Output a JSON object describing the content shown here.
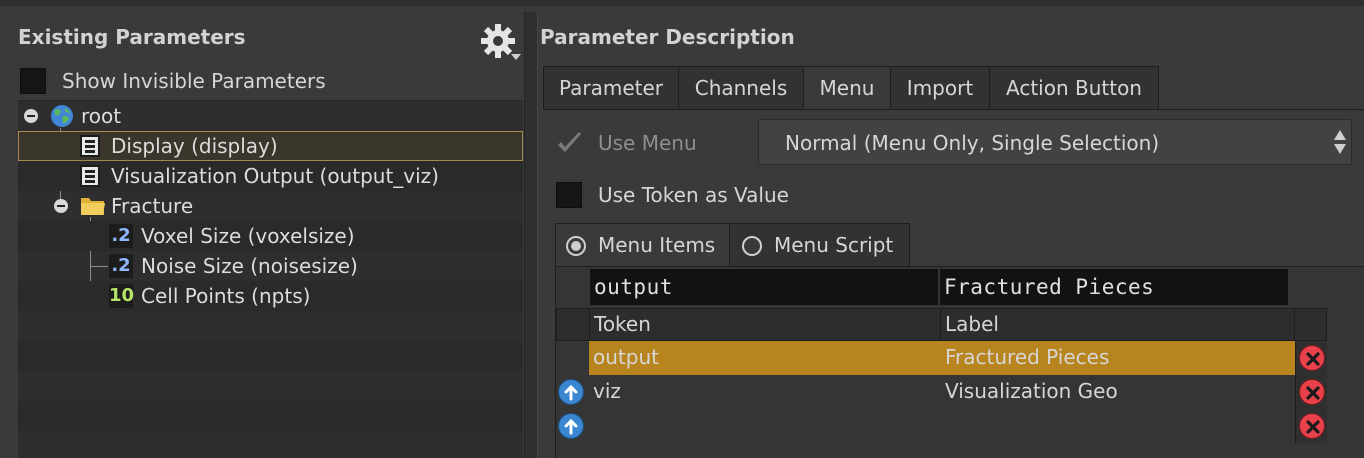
{
  "left_panel": {
    "title": "Existing Parameters",
    "show_invisible_label": "Show Invisible Parameters",
    "tree": [
      {
        "label": "root",
        "icon": "globe-icon"
      },
      {
        "label": "Display (display)",
        "icon": "menu-parm-icon",
        "selected": true
      },
      {
        "label": "Visualization Output (output_viz)",
        "icon": "menu-parm-icon"
      },
      {
        "label": "Fracture",
        "icon": "folder-icon"
      },
      {
        "label": "Voxel Size (voxelsize)",
        "badge": ".2",
        "badge_color": "#8fb6ff"
      },
      {
        "label": "Noise Size (noisesize)",
        "badge": ".2",
        "badge_color": "#8fb6ff"
      },
      {
        "label": "Cell Points (npts)",
        "badge": "10",
        "badge_color": "#b5e36a"
      }
    ]
  },
  "right_panel": {
    "title": "Parameter Description",
    "tabs": [
      "Parameter",
      "Channels",
      "Menu",
      "Import",
      "Action Button"
    ],
    "active_tab": "Menu",
    "use_menu_label": "Use Menu",
    "use_menu_checked": true,
    "menu_type_value": "Normal (Menu Only, Single Selection)",
    "use_token_label": "Use Token as Value",
    "subtabs": [
      "Menu Items",
      "Menu Script"
    ],
    "active_subtab": "Menu Items",
    "edit_token": "output",
    "edit_label": "Fractured Pieces",
    "columns": [
      "Token",
      "Label"
    ],
    "rows": [
      {
        "token": "output",
        "label": "Fractured Pieces",
        "selected": true
      },
      {
        "token": "viz",
        "label": "Visualization Geo"
      },
      {
        "token": "",
        "label": ""
      }
    ]
  },
  "colors": {
    "selection_accent": "#b8841e",
    "up_button": "#3a86d0",
    "delete_button": "#e8414a"
  }
}
